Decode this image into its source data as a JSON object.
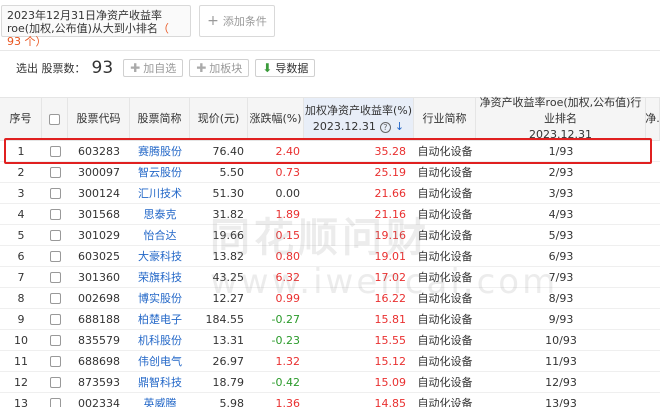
{
  "condition": {
    "text": "2023年12月31日净资产收益率roe(加权,公布值)从大到小排名",
    "count": "（ 93 个）"
  },
  "add_condition_label": "添加条件",
  "toolbar": {
    "selected_label": "选出 股票数：",
    "selected_count": "93",
    "add_watch_label": "加自选",
    "add_sector_label": "加板块",
    "export_label": "导数据"
  },
  "headers": {
    "index": "序号",
    "code": "股票代码",
    "name": "股票简称",
    "price": "现价(元)",
    "change": "涨跌幅(%)",
    "roe_line1": "加权净资产收益率(%)",
    "roe_line2": "2023.12.31",
    "industry": "行业简称",
    "rank_line1": "净资产收益率roe(加权,公布值)行业排名",
    "rank_line2": "2023.12.31",
    "more": "净."
  },
  "rows": [
    {
      "idx": "1",
      "code": "603283",
      "name": "赛腾股份",
      "price": "76.40",
      "change": "2.40",
      "dir": "up",
      "roe": "35.28",
      "industry": "自动化设备",
      "rank": "1/93"
    },
    {
      "idx": "2",
      "code": "300097",
      "name": "智云股份",
      "price": "5.50",
      "change": "0.73",
      "dir": "up",
      "roe": "25.19",
      "industry": "自动化设备",
      "rank": "2/93"
    },
    {
      "idx": "3",
      "code": "300124",
      "name": "汇川技术",
      "price": "51.30",
      "change": "0.00",
      "dir": "flat",
      "roe": "21.66",
      "industry": "自动化设备",
      "rank": "3/93"
    },
    {
      "idx": "4",
      "code": "301568",
      "name": "思泰克",
      "price": "31.82",
      "change": "1.89",
      "dir": "up",
      "roe": "21.16",
      "industry": "自动化设备",
      "rank": "4/93"
    },
    {
      "idx": "5",
      "code": "301029",
      "name": "怡合达",
      "price": "19.66",
      "change": "0.15",
      "dir": "up",
      "roe": "19.16",
      "industry": "自动化设备",
      "rank": "5/93"
    },
    {
      "idx": "6",
      "code": "603025",
      "name": "大豪科技",
      "price": "13.82",
      "change": "0.80",
      "dir": "up",
      "roe": "19.01",
      "industry": "自动化设备",
      "rank": "6/93"
    },
    {
      "idx": "7",
      "code": "301360",
      "name": "荣旗科技",
      "price": "43.25",
      "change": "6.32",
      "dir": "up",
      "roe": "17.02",
      "industry": "自动化设备",
      "rank": "7/93"
    },
    {
      "idx": "8",
      "code": "002698",
      "name": "博实股份",
      "price": "12.27",
      "change": "0.99",
      "dir": "up",
      "roe": "16.22",
      "industry": "自动化设备",
      "rank": "8/93"
    },
    {
      "idx": "9",
      "code": "688188",
      "name": "柏楚电子",
      "price": "184.55",
      "change": "-0.27",
      "dir": "down",
      "roe": "15.81",
      "industry": "自动化设备",
      "rank": "9/93"
    },
    {
      "idx": "10",
      "code": "835579",
      "name": "机科股份",
      "price": "13.31",
      "change": "-0.23",
      "dir": "down",
      "roe": "15.55",
      "industry": "自动化设备",
      "rank": "10/93"
    },
    {
      "idx": "11",
      "code": "688698",
      "name": "伟创电气",
      "price": "26.97",
      "change": "1.32",
      "dir": "up",
      "roe": "15.12",
      "industry": "自动化设备",
      "rank": "11/93"
    },
    {
      "idx": "12",
      "code": "873593",
      "name": "鼎智科技",
      "price": "18.79",
      "change": "-0.42",
      "dir": "down",
      "roe": "15.09",
      "industry": "自动化设备",
      "rank": "12/93"
    },
    {
      "idx": "13",
      "code": "002334",
      "name": "英威腾",
      "price": "5.98",
      "change": "1.36",
      "dir": "up",
      "roe": "14.85",
      "industry": "自动化设备",
      "rank": "13/93"
    }
  ],
  "watermark": {
    "line1": "同花顺问财",
    "line2": "www.iwencai.com"
  },
  "colors": {
    "up": "#e93030",
    "down": "#2a9a2a",
    "link": "#2468c8",
    "highlight": "#e02020"
  },
  "icons": {
    "add": "plus-icon",
    "export": "download-icon",
    "help": "question-circle-icon",
    "sort": "sort-desc-icon"
  }
}
